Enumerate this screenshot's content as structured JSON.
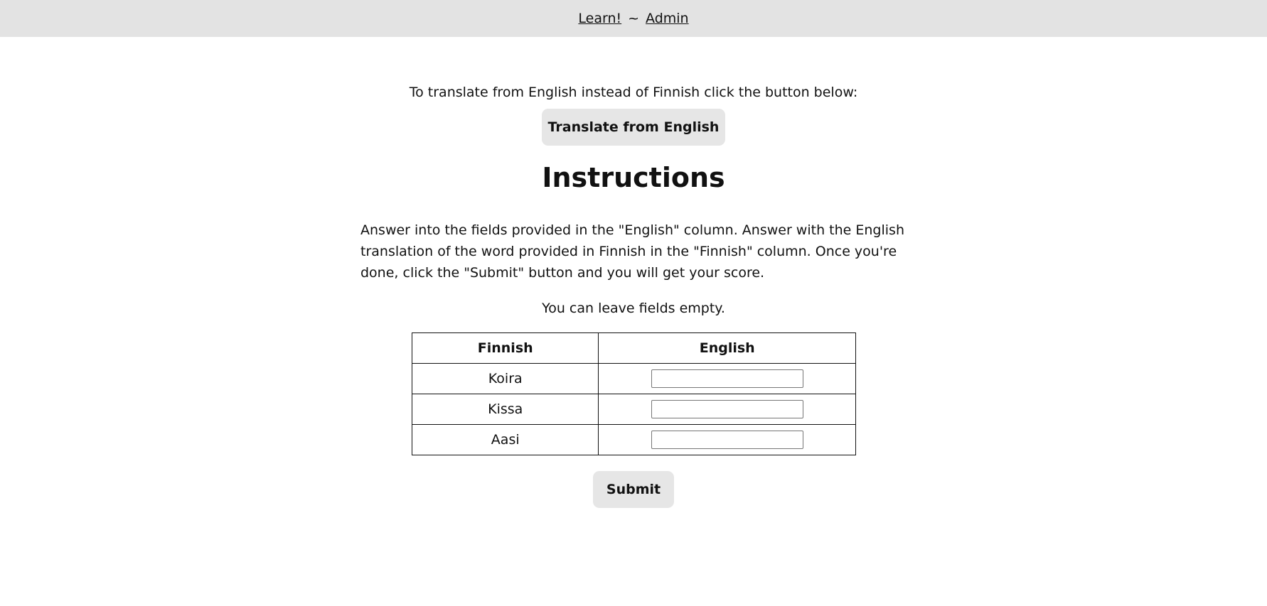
{
  "nav": {
    "learn_label": "Learn!",
    "separator": "~",
    "admin_label": "Admin"
  },
  "intro": {
    "text": "To translate from English instead of Finnish click the button below:",
    "button_label": "Translate from English"
  },
  "instructions": {
    "heading": "Instructions",
    "body": "Answer into the fields provided in the \"English\" column. Answer with the English translation of the word provided in Finnish in the \"Finnish\" column. Once you're done, click the \"Submit\" button and you will get your score.",
    "empty_note": "You can leave fields empty."
  },
  "table": {
    "headers": [
      "Finnish",
      "English"
    ],
    "rows": [
      {
        "finnish": "Koira",
        "english": ""
      },
      {
        "finnish": "Kissa",
        "english": ""
      },
      {
        "finnish": "Aasi",
        "english": ""
      }
    ]
  },
  "submit_label": "Submit"
}
